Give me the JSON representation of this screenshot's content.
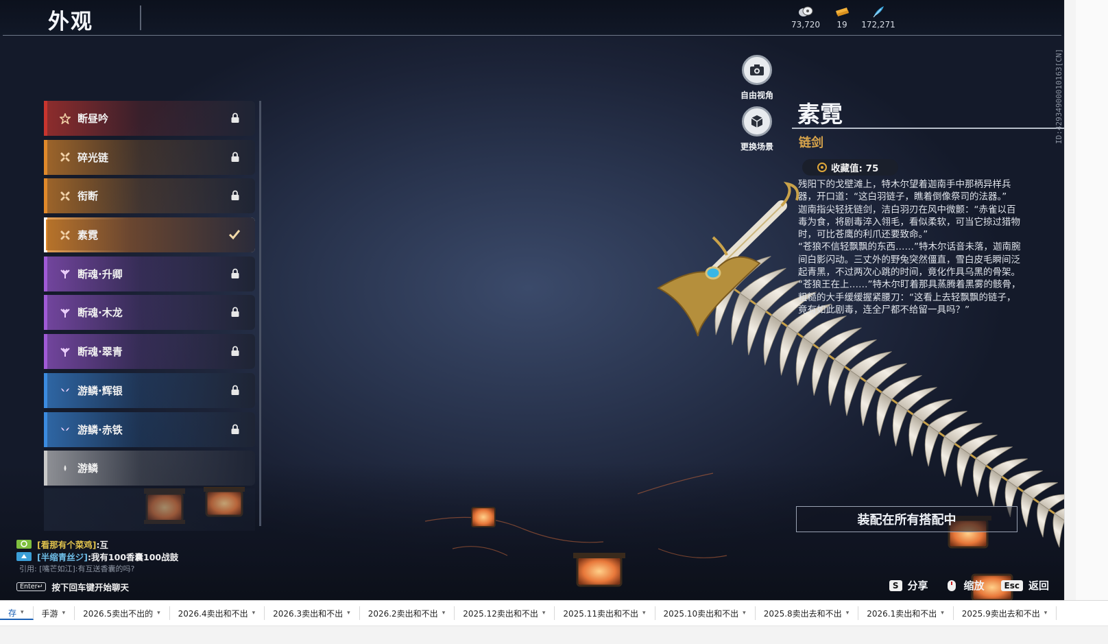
{
  "header": {
    "title": "外观",
    "currencies": [
      {
        "icon": "coin-stack-icon",
        "value": "73,720"
      },
      {
        "icon": "ticket-icon",
        "value": "19"
      },
      {
        "icon": "feather-icon",
        "value": "172,271"
      }
    ]
  },
  "camera": {
    "free_view_label": "自由视角",
    "change_scene_label": "更换场景"
  },
  "skins": [
    {
      "name": "断昼吟",
      "icon": "star-icon",
      "color": "#c8352e",
      "state": "locked"
    },
    {
      "name": "碎光链",
      "icon": "cross-icon",
      "color": "#e0892a",
      "state": "locked"
    },
    {
      "name": "衔断",
      "icon": "cross-icon",
      "color": "#e0892a",
      "state": "locked"
    },
    {
      "name": "素霓",
      "icon": "cross-icon",
      "color": "#e0892a",
      "state": "selected"
    },
    {
      "name": "断魂·升卿",
      "icon": "trident-icon",
      "color": "#a05ad6",
      "state": "locked"
    },
    {
      "name": "断魂·木龙",
      "icon": "trident-icon",
      "color": "#a05ad6",
      "state": "locked"
    },
    {
      "name": "断魂·翠青",
      "icon": "trident-icon",
      "color": "#a05ad6",
      "state": "locked"
    },
    {
      "name": "游鳞·辉银",
      "icon": "wing-icon",
      "color": "#3b8be0",
      "state": "locked"
    },
    {
      "name": "游鳞·赤铁",
      "icon": "wing-icon",
      "color": "#3b8be0",
      "state": "locked"
    },
    {
      "name": "游鳞",
      "icon": "drop-icon",
      "color": "#c9c9c9",
      "state": "owned"
    }
  ],
  "detail": {
    "name": "素霓",
    "type": "链剑",
    "collection_label": "收藏值: 75",
    "story": [
      "残阳下的戈壁滩上，特木尔望着迦南手中那柄异样兵器，开口道：“这白羽链子，瞧着倒像祭司的法器。”",
      "迦南指尖轻抚链剑，洁白羽刃在风中微颤：“赤雀以百毒为食，将剧毒淬入翎毛，看似柔软，可当它掠过猎物时，可比苍鹰的利爪还要致命。”",
      "“苍狼不信轻飘飘的东西……”特木尔话音未落，迦南腕间白影闪动。三丈外的野兔突然僵直，雪白皮毛瞬间泛起青黑，不过两次心跳的时间，竟化作具乌黑的骨架。",
      "“苍狼王在上……”特木尔盯着那具蒸腾着黑雾的骸骨，粗糙的大手缓缓握紧腰刀：“这看上去轻飘飘的链子，竟有如此剧毒，连全尸都不给留一具吗？”"
    ],
    "equip_label": "装配在所有搭配中",
    "id_text": "ID:4293490001016З[CN]"
  },
  "chat": {
    "messages": [
      {
        "channel_color": "#7fbf3f",
        "sender": "[看那有个菜鸡]",
        "text": ":互",
        "sender_class": "g"
      },
      {
        "channel_color": "#3b9fd8",
        "sender": "[半缩青丝ジ]",
        "text": ":我有100香囊100战鼓",
        "sender_class": "b"
      }
    ],
    "quote": "引用: [嘴芒如江]:有互送香囊的吗?",
    "enter_key": "Enter↵",
    "enter_hint": "按下回车键开始聊天"
  },
  "hints": [
    {
      "key": "S",
      "label": "分享"
    },
    {
      "key": "",
      "label": "缩放"
    },
    {
      "key": "Esc",
      "label": "返回"
    }
  ],
  "sheet_tabs": [
    "存",
    "手游",
    "2026.5卖出不出的",
    "2026.4卖出和不出",
    "2026.3卖出和不出",
    "2026.2卖出和不出",
    "2025.12卖出和不出",
    "2025.11卖出和不出",
    "2025.10卖出和不出",
    "2025.8卖出去和不出",
    "2026.1卖出和不出",
    "2025.9卖出去和不出"
  ]
}
